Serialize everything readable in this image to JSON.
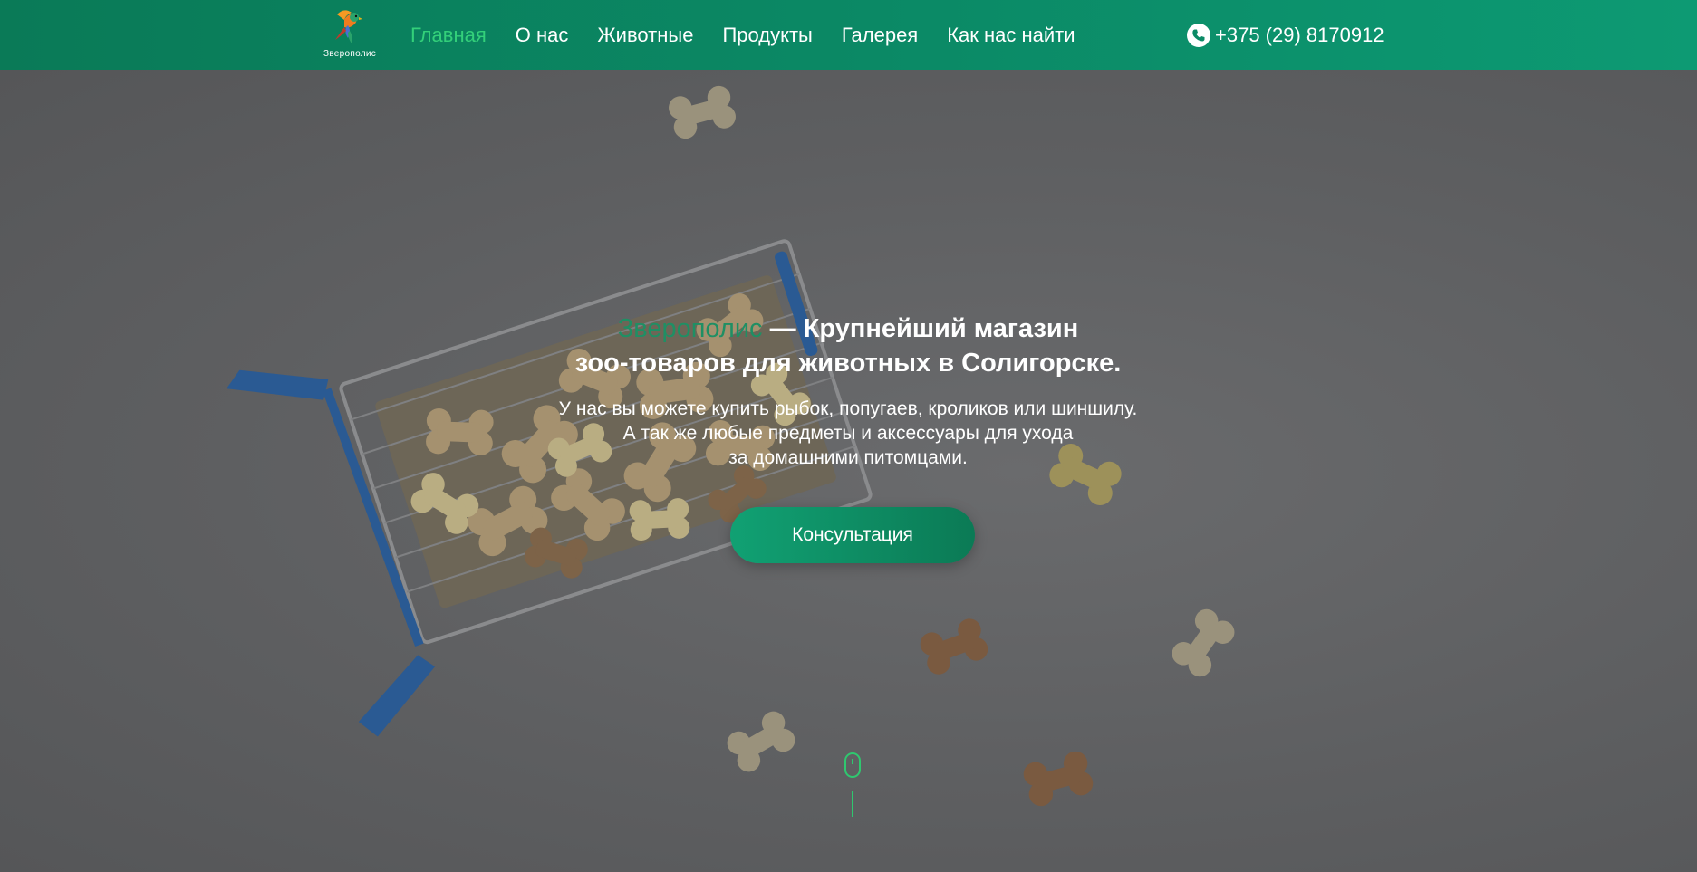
{
  "header": {
    "logo_text": "Зверополис",
    "nav": [
      {
        "label": "Главная",
        "active": true
      },
      {
        "label": "О нас"
      },
      {
        "label": "Животные"
      },
      {
        "label": "Продукты"
      },
      {
        "label": "Галерея"
      },
      {
        "label": "Как нас найти"
      }
    ],
    "phone": "+375 (29) 8170912"
  },
  "hero": {
    "brand": "Зверополис",
    "title_line1_rest": " — Крупнейший магазин",
    "title_line2": "зоо-товаров для животных в Солигорске.",
    "text_line1": "У нас вы можете купить рыбок, попугаев, кроликов или шиншилу.",
    "text_line2": "А так же любые предметы и аксессуары для ухода",
    "text_line3": "за домашними питомцами.",
    "cta_label": "Консультация"
  },
  "colors": {
    "header_bg": "#0b8a66",
    "accent_green": "#33d07a",
    "brand_green": "#1f8f64",
    "button_bg": "#0e8d64"
  },
  "icons": {
    "logo": "parrot-logo-icon",
    "phone": "phone-icon",
    "scroll": "mouse-scroll-icon"
  }
}
